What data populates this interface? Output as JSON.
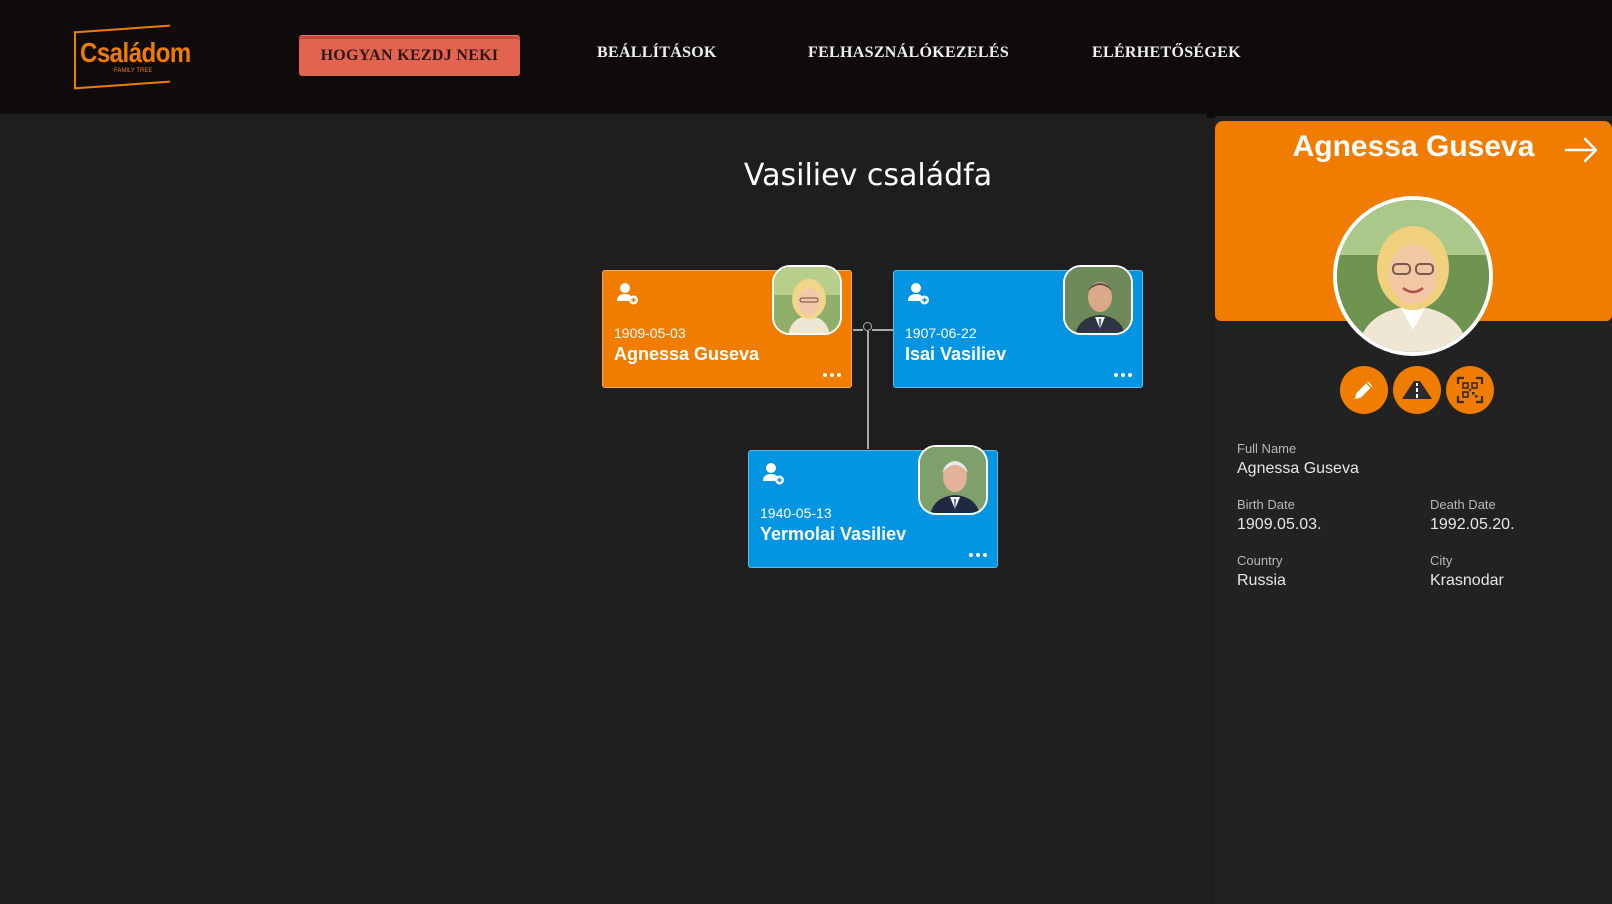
{
  "header": {
    "logo_text": "Családom",
    "logo_sub": "FAMILY TREE",
    "nav": {
      "cta": "HOGYAN KEZDJ NEKI",
      "settings": "BEÁLLÍTÁSOK",
      "users": "FELHASZNÁLÓKEZELÉS",
      "contacts": "ELÉRHETŐSÉGEK"
    }
  },
  "tree": {
    "title": "Vasiliev családfa",
    "cards": [
      {
        "name": "Agnessa Guseva",
        "date": "1909-05-03",
        "gender": "female"
      },
      {
        "name": "Isai Vasiliev",
        "date": "1907-06-22",
        "gender": "male"
      },
      {
        "name": "Yermolai Vasiliev",
        "date": "1940-05-13",
        "gender": "male"
      }
    ]
  },
  "panel": {
    "name": "Agnessa Guseva",
    "fields": {
      "full_name_label": "Full Name",
      "full_name": "Agnessa Guseva",
      "birth_label": "Birth Date",
      "birth": "1909.05.03.",
      "death_label": "Death Date",
      "death": "1992.05.20.",
      "country_label": "Country",
      "country": "Russia",
      "city_label": "City",
      "city": "Krasnodar"
    },
    "actions": [
      "pencil-icon",
      "road-icon",
      "qr-scan-icon"
    ]
  },
  "colors": {
    "accent_orange": "#f07c00",
    "male_blue": "#0394e2",
    "cta_red": "#e2644f",
    "topbar": "#0f0b0b",
    "background": "#1e1e1e"
  }
}
